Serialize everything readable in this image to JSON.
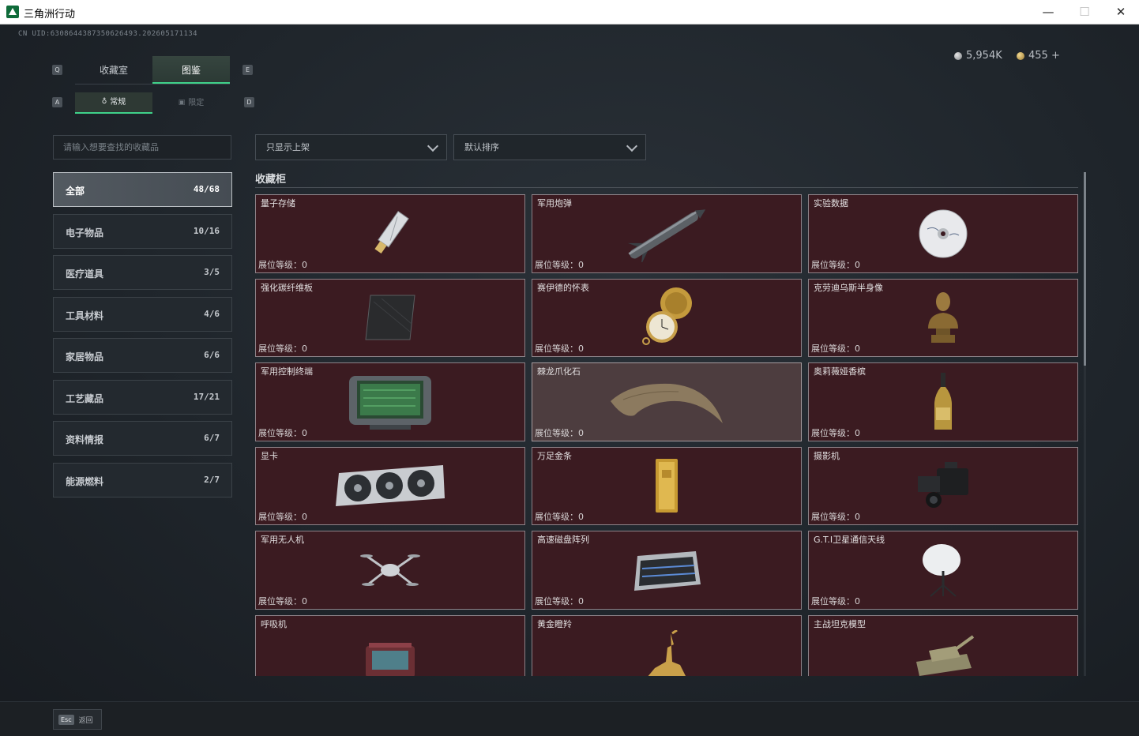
{
  "window": {
    "title": "三角洲行动",
    "min": "—",
    "max": "☐",
    "close": "✕"
  },
  "uid": "CN UID:6308644387350626493.202605171134",
  "currency": {
    "silver": "5,954K",
    "gold": "455 +"
  },
  "tabs": {
    "key_left": "Q",
    "key_right": "E",
    "items": [
      {
        "label": "收藏室"
      },
      {
        "label": "图鉴"
      }
    ]
  },
  "subtabs": {
    "key_left": "A",
    "key_right": "D",
    "items": [
      {
        "label": "常规",
        "icon": "♁"
      },
      {
        "label": "限定",
        "icon": "▣"
      }
    ]
  },
  "search": {
    "placeholder": "请输入想要查找的收藏品"
  },
  "categories": [
    {
      "name": "全部",
      "count": "48/68"
    },
    {
      "name": "电子物品",
      "count": "10/16"
    },
    {
      "name": "医疗道具",
      "count": "3/5"
    },
    {
      "name": "工具材料",
      "count": "4/6"
    },
    {
      "name": "家居物品",
      "count": "6/6"
    },
    {
      "name": "工艺藏品",
      "count": "17/21"
    },
    {
      "name": "资料情报",
      "count": "6/7"
    },
    {
      "name": "能源燃料",
      "count": "2/7"
    }
  ],
  "filters": {
    "shelf": "只显示上架",
    "sort": "默认排序"
  },
  "section": {
    "title": "收藏柜"
  },
  "level_label": "展位等级：",
  "items": [
    {
      "name": "量子存储",
      "level": "0",
      "icon": "usb-drive"
    },
    {
      "name": "军用炮弹",
      "level": "0",
      "icon": "missile"
    },
    {
      "name": "实验数据",
      "level": "0",
      "icon": "disc"
    },
    {
      "name": "强化碳纤维板",
      "level": "0",
      "icon": "carbon-plate"
    },
    {
      "name": "赛伊德的怀表",
      "level": "0",
      "icon": "pocket-watch"
    },
    {
      "name": "克劳迪乌斯半身像",
      "level": "0",
      "icon": "bust"
    },
    {
      "name": "军用控制终端",
      "level": "0",
      "icon": "terminal"
    },
    {
      "name": "棘龙爪化石",
      "level": "0",
      "icon": "claw-fossil"
    },
    {
      "name": "奥莉薇娅香槟",
      "level": "0",
      "icon": "champagne"
    },
    {
      "name": "显卡",
      "level": "0",
      "icon": "gpu"
    },
    {
      "name": "万足金条",
      "level": "0",
      "icon": "gold-bar"
    },
    {
      "name": "摄影机",
      "level": "0",
      "icon": "camera"
    },
    {
      "name": "军用无人机",
      "level": "0",
      "icon": "drone"
    },
    {
      "name": "高速磁盘阵列",
      "level": "0",
      "icon": "disk-array"
    },
    {
      "name": "G.T.I卫星通信天线",
      "level": "0",
      "icon": "satellite-dish"
    },
    {
      "name": "呼吸机",
      "level": "",
      "icon": "ventilator"
    },
    {
      "name": "黄金瞪羚",
      "level": "",
      "icon": "gold-gazelle"
    },
    {
      "name": "主战坦克模型",
      "level": "",
      "icon": "tank-model"
    }
  ],
  "footer": {
    "esc_key": "Esc",
    "esc_label": "返回"
  }
}
